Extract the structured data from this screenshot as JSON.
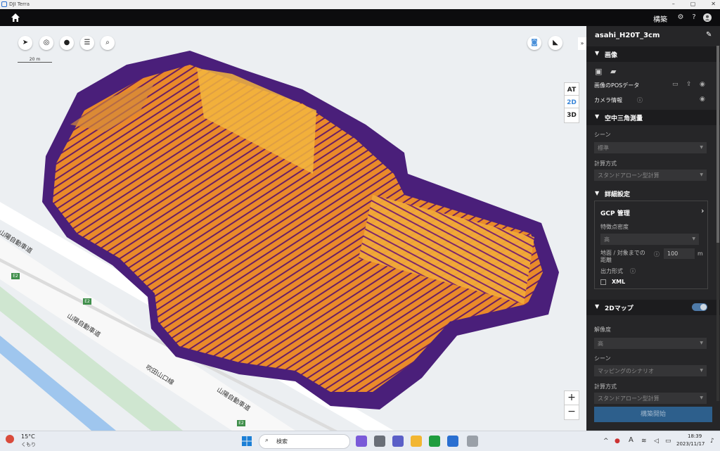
{
  "window": {
    "title": "DJI Terra",
    "buttons": [
      "–",
      "▢",
      "✕"
    ]
  },
  "topbar": {
    "mode_label": "構築"
  },
  "map": {
    "scale_label": "20 m",
    "view_modes": [
      "AT",
      "2D",
      "3D"
    ],
    "active_view": "2D",
    "zoom_in": "+",
    "zoom_out": "−",
    "collapse_label": "»",
    "road_labels": [
      "山陽自動車道",
      "山陽自動車道",
      "吹田山口線",
      "山陽自動車道"
    ],
    "route_badge": "E2"
  },
  "panel": {
    "mission_name": "asahi_H20T_3cm",
    "sections": {
      "images": {
        "title": "画像",
        "pos_data": "画像のPOSデータ",
        "camera_info": "カメラ情報"
      },
      "aerial_triangulation": {
        "title": "空中三角測量",
        "scene_label": "シーン",
        "scene_value": "標準",
        "calc_label": "計算方式",
        "calc_value": "スタンドアローン型計算"
      },
      "advanced": {
        "title": "詳細設定",
        "gcp_label": "GCP 管理",
        "density_label": "特徴点密度",
        "density_value": "高",
        "distance_label_1": "地面 / 対象までの",
        "distance_label_2": "距離",
        "distance_value": "100",
        "distance_unit": "m",
        "output_label": "出力形式",
        "xml_label": "XML"
      },
      "map2d": {
        "title": "2Dマップ",
        "resolution_label": "解像度",
        "resolution_value": "高",
        "scene_label": "シーン",
        "scene_value": "マッピングのシナリオ",
        "calc_label": "計算方式",
        "calc_value": "スタンドアローン型計算"
      }
    },
    "start_button": "構築開始"
  },
  "taskbar": {
    "weather_temp": "15°C",
    "weather_desc": "くもり",
    "search_placeholder": "検索",
    "time": "18:39",
    "date": "2023/11/17",
    "ime": "A"
  }
}
